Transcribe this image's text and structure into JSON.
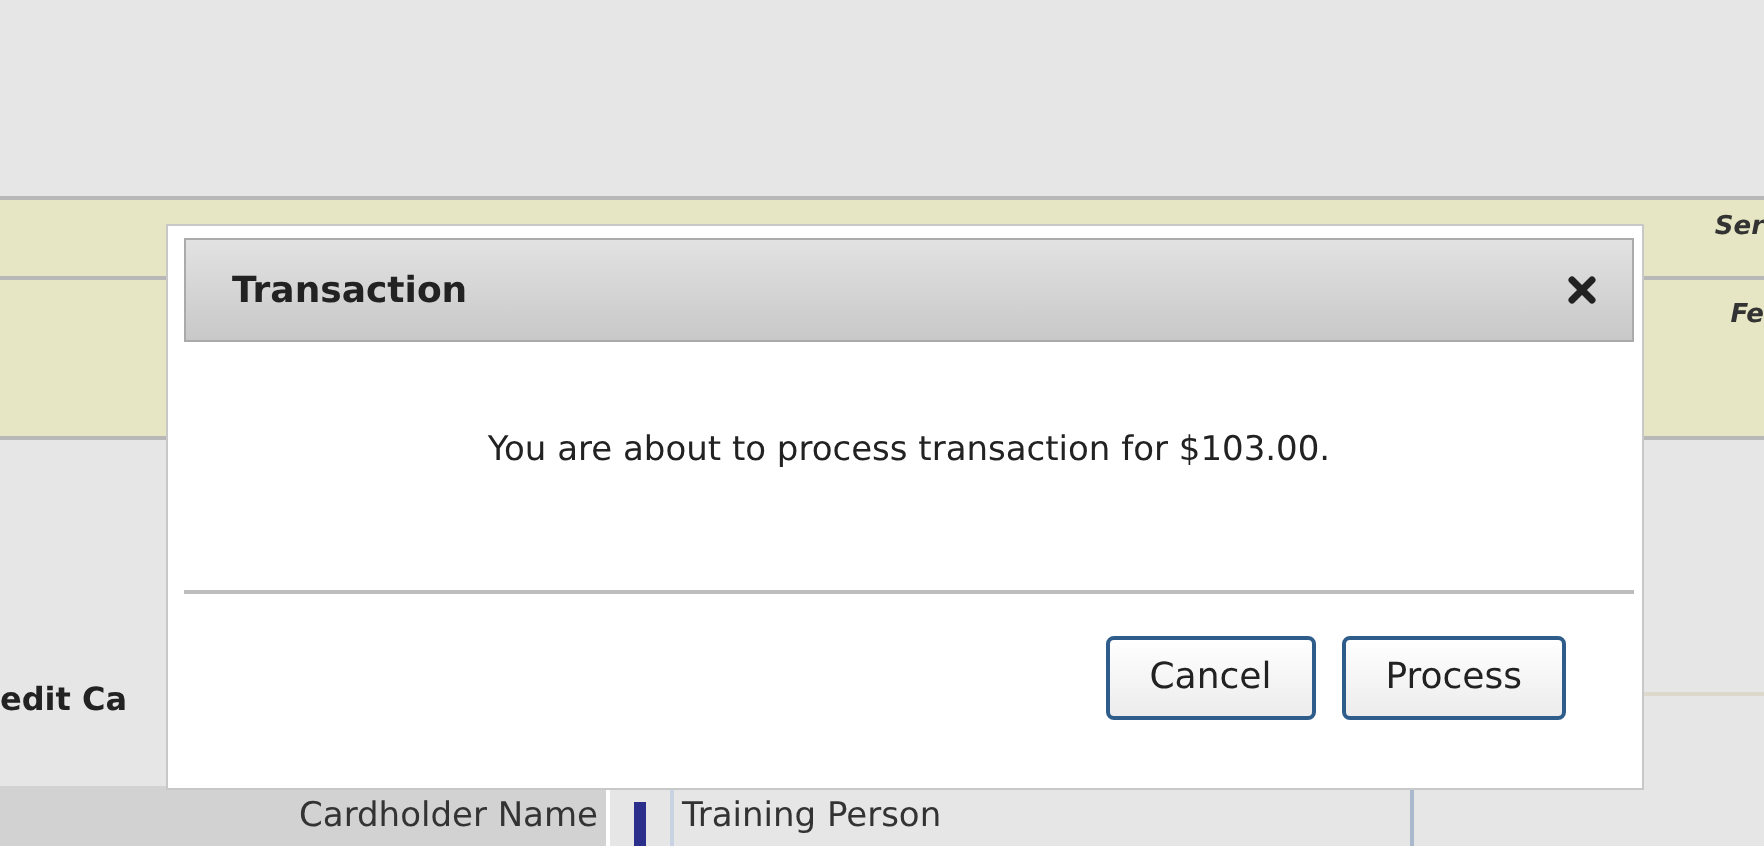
{
  "background": {
    "header_labels": [
      "Ser",
      "Fe"
    ],
    "section_label": "edit Ca",
    "fields": [
      {
        "label": "Cardholder Name",
        "value": "Training Person"
      }
    ]
  },
  "dialog": {
    "title": "Transaction",
    "message": "You are about to process transaction for $103.00.",
    "buttons": [
      {
        "label": "Cancel"
      },
      {
        "label": "Process"
      }
    ]
  }
}
